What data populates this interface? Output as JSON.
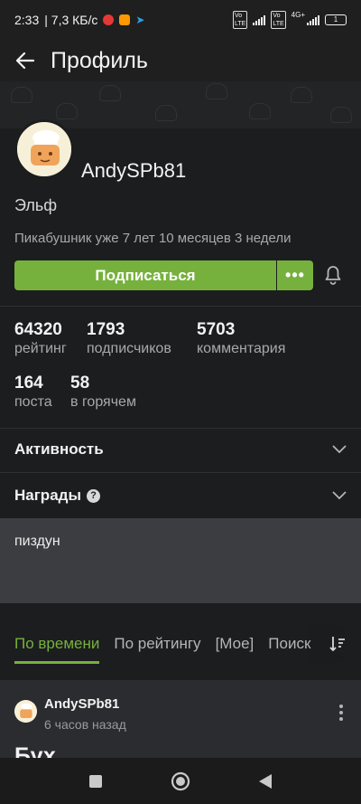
{
  "status_bar": {
    "time": "2:33",
    "speed": "| 7,3 КБ/с",
    "network": "4G+",
    "battery": "1",
    "volte_label": "Vo LTE",
    "chip_colors": [
      "#e53935",
      "#ff9800",
      "#2aa1e6"
    ]
  },
  "appbar": {
    "back_icon": "arrow-left-icon",
    "title": "Профиль"
  },
  "profile": {
    "username": "AndySPb81",
    "rank": "Эльф",
    "member_since": "Пикабушник уже 7 лет 10 месяцев 3 недели",
    "subscribe_label": "Подписаться",
    "more_label": "•••",
    "bell_icon": "bell-icon",
    "accent_color": "#76b13d"
  },
  "stats": [
    {
      "value": "64320",
      "label": "рейтинг"
    },
    {
      "value": "1793",
      "label": "подписчиков"
    },
    {
      "value": "5703",
      "label": "комментария"
    },
    {
      "value": "164",
      "label": "поста"
    },
    {
      "value": "58",
      "label": "в горячем"
    }
  ],
  "sections": {
    "activity": "Активность",
    "awards": "Награды",
    "awards_help": "?"
  },
  "about": {
    "text": "пиздун"
  },
  "tabs": [
    {
      "label": "По времени",
      "active": true
    },
    {
      "label": "По рейтингу",
      "active": false
    },
    {
      "label": "[Мое]",
      "active": false
    },
    {
      "label": "Поиск",
      "active": false
    }
  ],
  "post": {
    "author": "AndySPb81",
    "time": "6 часов назад",
    "title": "Бух"
  }
}
